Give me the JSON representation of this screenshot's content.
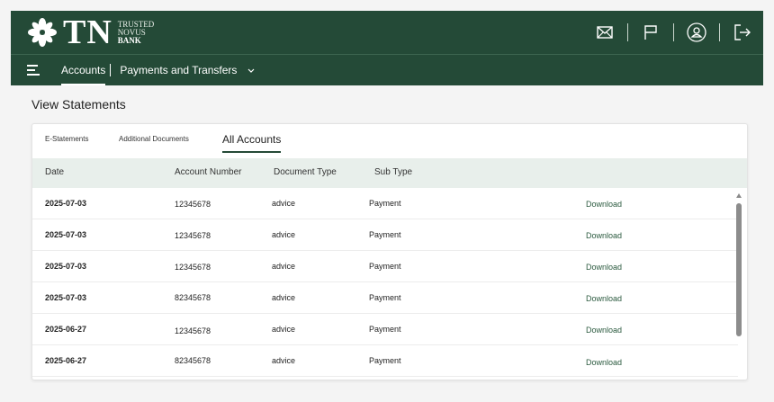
{
  "brand": {
    "short": "TN",
    "line1": "TRUSTED",
    "line2": "NOVUS",
    "line3": "BANK"
  },
  "header_icons": [
    "mail-icon",
    "flag-icon",
    "user-icon",
    "logout-icon"
  ],
  "nav": {
    "accounts": "Accounts",
    "payments": "Payments and Transfers",
    "chevron": "⌄"
  },
  "page": {
    "title": "View Statements"
  },
  "tabs": [
    {
      "label": "E-Statements",
      "active": false
    },
    {
      "label": "Additional Documents",
      "active": false
    },
    {
      "label": "All Accounts",
      "active": true
    }
  ],
  "table": {
    "columns": [
      "Date",
      "Account Number",
      "Document Type",
      "Sub Type"
    ],
    "rows": [
      {
        "date": "2025-07-03",
        "account": "12345678",
        "doc_type": "advice",
        "sub_type": "Payment",
        "action": "Download"
      },
      {
        "date": "2025-07-03",
        "account": "12345678",
        "doc_type": "advice",
        "sub_type": "Payment",
        "action": "Download"
      },
      {
        "date": "2025-07-03",
        "account": "12345678",
        "doc_type": "advice",
        "sub_type": "Payment",
        "action": "Download"
      },
      {
        "date": "2025-07-03",
        "account": "82345678",
        "doc_type": "advice",
        "sub_type": "Payment",
        "action": "Download"
      },
      {
        "date": "2025-06-27",
        "account": "12345678",
        "doc_type": "advice",
        "sub_type": "Payment",
        "action": "Download"
      },
      {
        "date": "2025-06-27",
        "account": "82345678",
        "doc_type": "advice",
        "sub_type": "Payment",
        "action": "Download"
      }
    ]
  },
  "colors": {
    "brand_green": "#244a37",
    "header_tint": "#e8efeb",
    "link_green": "#2b5a3f"
  }
}
